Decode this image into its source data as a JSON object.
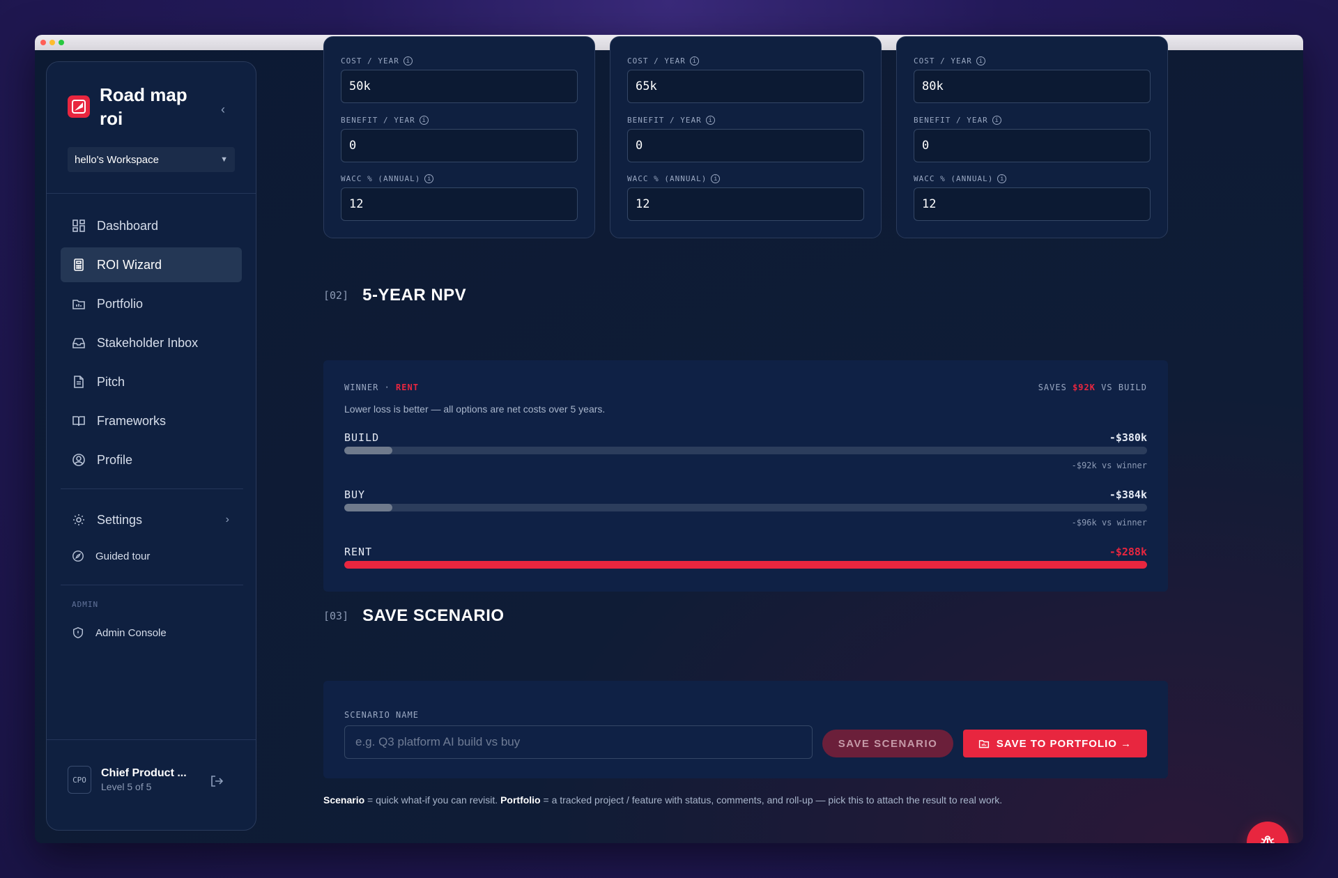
{
  "app": {
    "name": "Road map roi",
    "workspace": "hello's Workspace",
    "collapse_glyph": "‹"
  },
  "nav": {
    "items": [
      {
        "label": "Dashboard",
        "icon": "dashboard-icon"
      },
      {
        "label": "ROI Wizard",
        "icon": "calculator-icon"
      },
      {
        "label": "Portfolio",
        "icon": "folder-icon"
      },
      {
        "label": "Stakeholder Inbox",
        "icon": "inbox-icon"
      },
      {
        "label": "Pitch",
        "icon": "document-icon"
      },
      {
        "label": "Frameworks",
        "icon": "book-icon"
      },
      {
        "label": "Profile",
        "icon": "user-circle-icon"
      }
    ],
    "active": "ROI Wizard",
    "settings_label": "Settings",
    "guided_tour_label": "Guided tour",
    "admin_section_label": "ADMIN",
    "admin_console_label": "Admin Console"
  },
  "user": {
    "initials": "CPO",
    "name": "Chief Product ...",
    "level": "Level 5 of 5"
  },
  "options": [
    {
      "cost_label": "COST / YEAR",
      "cost": "50k",
      "benefit_label": "BENEFIT / YEAR",
      "benefit": "0",
      "wacc_label": "WACC % (ANNUAL)",
      "wacc": "12"
    },
    {
      "cost_label": "COST / YEAR",
      "cost": "65k",
      "benefit_label": "BENEFIT / YEAR",
      "benefit": "0",
      "wacc_label": "WACC % (ANNUAL)",
      "wacc": "12"
    },
    {
      "cost_label": "COST / YEAR",
      "cost": "80k",
      "benefit_label": "BENEFIT / YEAR",
      "benefit": "0",
      "wacc_label": "WACC % (ANNUAL)",
      "wacc": "12"
    }
  ],
  "npv": {
    "section_num": "[02]",
    "section_title": "5-YEAR NPV",
    "winner_prefix": "WINNER ·",
    "winner": "RENT",
    "saves_prefix": "SAVES",
    "saves_amount": "$92K",
    "saves_suffix": "VS BUILD",
    "subtitle": "Lower loss is better — all options are net costs over 5 years.",
    "bars": [
      {
        "name": "BUILD",
        "value": "-$380k",
        "diff": "-$92k vs winner",
        "fill_fraction": 0.06,
        "winner": false
      },
      {
        "name": "BUY",
        "value": "-$384k",
        "diff": "-$96k vs winner",
        "fill_fraction": 0.06,
        "winner": false
      },
      {
        "name": "RENT",
        "value": "-$288k",
        "diff": "",
        "fill_fraction": 1.0,
        "winner": true
      }
    ]
  },
  "save": {
    "section_num": "[03]",
    "section_title": "SAVE SCENARIO",
    "field_label": "SCENARIO NAME",
    "placeholder": "e.g. Q3 platform AI build vs buy",
    "save_button": "SAVE SCENARIO",
    "portfolio_button": "SAVE TO PORTFOLIO →",
    "note_scenario_term": "Scenario",
    "note_scenario_def": "= quick what-if you can revisit.",
    "note_portfolio_term": "Portfolio",
    "note_portfolio_def": "= a tracked project / feature with status, comments, and roll-up — pick this to attach the result to real work."
  },
  "colors": {
    "accent": "#e8263f",
    "background": "#0c1a33",
    "panel": "#0f2145"
  }
}
